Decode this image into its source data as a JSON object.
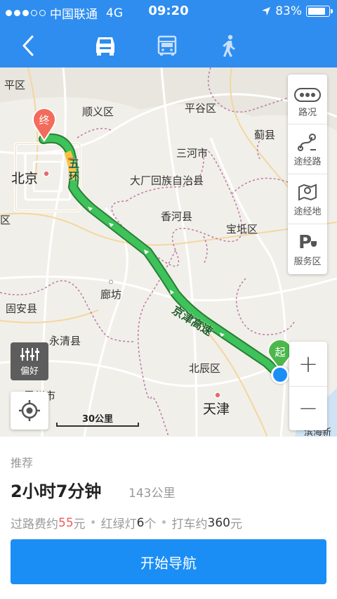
{
  "status": {
    "carrier": "中国联通",
    "network": "4G",
    "time": "09:20",
    "battery_pct": 83,
    "battery_label": "83%",
    "signal_bars_filled": 3,
    "signal_bars_total": 5
  },
  "nav": {
    "back_icon": "chevron-left-icon",
    "modes": [
      {
        "name": "car",
        "icon": "car-icon",
        "active": true
      },
      {
        "name": "bus",
        "icon": "bus-icon",
        "active": false
      },
      {
        "name": "walk",
        "icon": "walk-icon",
        "active": false
      }
    ]
  },
  "map": {
    "places": {
      "pingqu": "平区",
      "shunyi": "顺义区",
      "pinggu": "平谷区",
      "jixian": "蓟县",
      "beijing": "北京",
      "sanhe": "三河市",
      "dachang": "大厂回族自治县",
      "xianghe": "香河县",
      "baodi": "宝坻区",
      "qu": "区",
      "langfang": "廊坊",
      "guan": "固安县",
      "yongqing": "永清县",
      "beichen": "北辰区",
      "bazhou": "霸州市",
      "tianjin": "天津",
      "binhai": "滨海新"
    },
    "road_labels": {
      "ring": "五环",
      "expressway": "京津高速"
    },
    "end_marker": "终",
    "start_marker": "起",
    "scale": "30公里",
    "side_buttons": [
      "路况",
      "途经路",
      "途经地",
      "服务区"
    ],
    "preference": "偏好",
    "zoom_in": "+",
    "zoom_out": "−"
  },
  "route": {
    "tag": "推荐",
    "duration": "2小时7分钟",
    "distance": "143公里",
    "toll_prefix": "过路费约",
    "toll_value": "55",
    "toll_unit": "元",
    "lights_prefix": "红绿灯",
    "lights_value": "6",
    "lights_unit": "个",
    "taxi_prefix": "打车约",
    "taxi_value": "360",
    "taxi_unit": "元",
    "separator": "•",
    "start_button": "开始导航"
  },
  "colors": {
    "primary": "#2f8df0",
    "button": "#1a8ef5",
    "route": "#3ec25a",
    "end_pin": "#f26b5b",
    "start_pin": "#4cb84c",
    "toll": "#f05b5b"
  }
}
